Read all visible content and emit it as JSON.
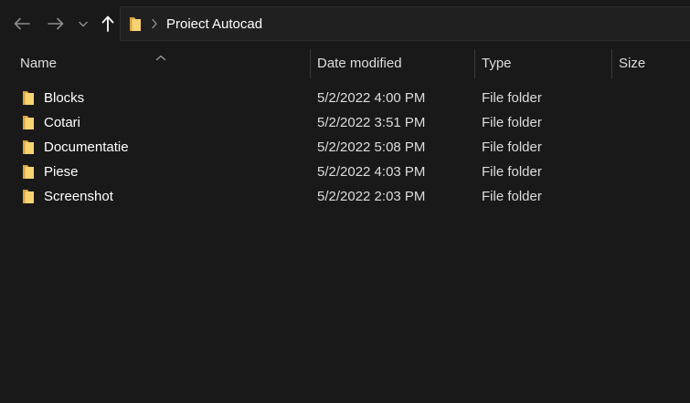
{
  "window": {
    "accent_color": "#0a64ad",
    "background": "#191919"
  },
  "toolbar": {
    "back_icon": "arrow-left-icon",
    "forward_icon": "arrow-right-icon",
    "recent_icon": "chevron-down-icon",
    "up_icon": "arrow-up-icon"
  },
  "address": {
    "folder_icon": "folder-icon",
    "separator_icon": "chevron-right-icon",
    "path": "Proiect Autocad"
  },
  "columns": {
    "name": "Name",
    "date_modified": "Date modified",
    "type": "Type",
    "size": "Size",
    "sorted_by": "Name",
    "sort_icon": "sort-up-icon"
  },
  "files": [
    {
      "name": "Blocks",
      "date_modified": "5/2/2022 4:00 PM",
      "type": "File folder",
      "icon": "folder-icon"
    },
    {
      "name": "Cotari",
      "date_modified": "5/2/2022 3:51 PM",
      "type": "File folder",
      "icon": "folder-icon"
    },
    {
      "name": "Documentatie",
      "date_modified": "5/2/2022 5:08 PM",
      "type": "File folder",
      "icon": "folder-icon"
    },
    {
      "name": "Piese",
      "date_modified": "5/2/2022 4:03 PM",
      "type": "File folder",
      "icon": "folder-icon"
    },
    {
      "name": "Screenshot",
      "date_modified": "5/2/2022 2:03 PM",
      "type": "File folder",
      "icon": "folder-icon"
    }
  ]
}
